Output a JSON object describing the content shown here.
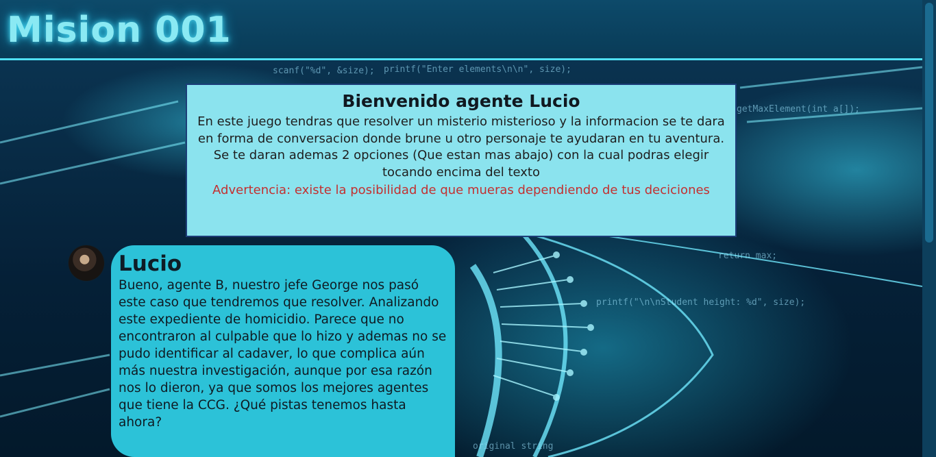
{
  "header": {
    "title": "Mision 001"
  },
  "background": {
    "code_snippets": [
      "scanf(\"%d\", &size);",
      "printf(\"Enter elements\\n\\n\", size);",
      "getMaxElement(int a[]);",
      "return max;",
      "printf(\"\\n\\nStudent height: %d\", size);",
      "original string"
    ]
  },
  "welcome": {
    "heading": "Bienvenido agente Lucio",
    "description": "En este juego tendras que resolver un misterio misterioso y la informacion se te dara en forma de conversacion donde brune u otro personaje te ayudaran en tu aventura. Se te daran ademas 2 opciones (Que estan mas abajo) con la cual podras elegir tocando encima del texto",
    "warning": "Advertencia: existe la posibilidad de que mueras dependiendo de tus deciciones"
  },
  "dialogue": {
    "speaker": "Lucio",
    "message": "Bueno, agente B, nuestro jefe George nos pasó este caso que tendremos que resolver. Analizando este expediente de homicidio. Parece que no encontraron al culpable que lo hizo y ademas no se pudo identificar al cadaver, lo que complica aún más nuestra investigación, aunque por esa razón nos lo dieron, ya que somos los mejores agentes que tiene la CCG. ¿Qué pistas tenemos hasta ahora?"
  },
  "colors": {
    "header_bg": "#0d4a6a",
    "title_glow": "#8ae9f3",
    "welcome_bg": "#8be3ee",
    "warning_text": "#c33030",
    "bubble_bg": "#2cc2d8"
  }
}
